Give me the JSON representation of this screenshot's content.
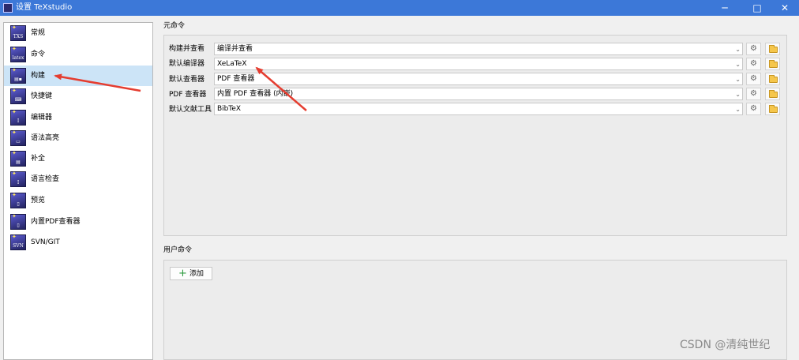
{
  "window": {
    "title": "设置 TeXstudio",
    "app_icon": "texstudio-icon",
    "controls": {
      "minimize": "─",
      "maximize": "□",
      "close": "✕"
    }
  },
  "sidebar": {
    "selected_index": 2,
    "selected_color": "#cce4f7",
    "items": [
      {
        "label": "常规",
        "icon": "txs-icon",
        "glyph": "TXS"
      },
      {
        "label": "命令",
        "icon": "latex-icon",
        "glyph": "latex"
      },
      {
        "label": "构建",
        "icon": "build-icon",
        "glyph": "▤▪"
      },
      {
        "label": "快捷键",
        "icon": "keyboard-icon",
        "glyph": "⌨"
      },
      {
        "label": "编辑器",
        "icon": "editor-icon",
        "glyph": "I"
      },
      {
        "label": "语法高亮",
        "icon": "highlight-icon",
        "glyph": "▭"
      },
      {
        "label": "补全",
        "icon": "completion-icon",
        "glyph": "▤"
      },
      {
        "label": "语言检查",
        "icon": "spellcheck-icon",
        "glyph": "I"
      },
      {
        "label": "预览",
        "icon": "preview-icon",
        "glyph": "▯"
      },
      {
        "label": "内置PDF查看器",
        "icon": "pdf-viewer-icon",
        "glyph": "▯"
      },
      {
        "label": "SVN/GIT",
        "icon": "svn-icon",
        "glyph": "SVN"
      }
    ]
  },
  "meta_commands": {
    "title": "元命令",
    "rows": [
      {
        "label": "构建并查看",
        "value": "编译并查看"
      },
      {
        "label": "默认编译器",
        "value": "XeLaTeX"
      },
      {
        "label": "默认查看器",
        "value": "PDF 查看器"
      },
      {
        "label": "PDF 查看器",
        "value": "内置 PDF 查看器 (内嵌)"
      },
      {
        "label": "默认文献工具",
        "value": "BibTeX"
      }
    ],
    "gear_glyph": "⚙",
    "dropdown_glyph": "⌄"
  },
  "user_commands": {
    "title": "用户命令",
    "add_label": "添加",
    "add_glyph": "+"
  },
  "watermark": "CSDN @清纯世纪",
  "colors": {
    "titlebar": "#3c78d8",
    "annotation_arrow": "#e53d30"
  }
}
